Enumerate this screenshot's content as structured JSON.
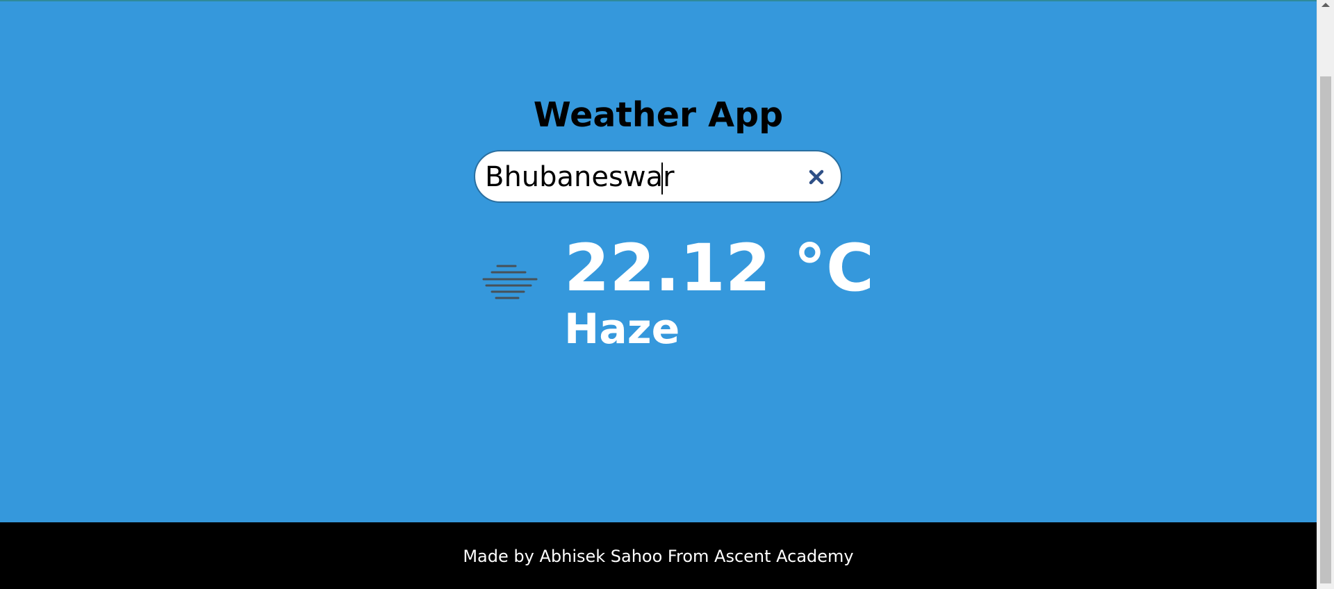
{
  "app": {
    "title": "Weather App"
  },
  "search": {
    "value": "Bhubaneswar",
    "clear_icon": "close-icon"
  },
  "weather": {
    "temperature": "22.12 °C",
    "condition": "Haze",
    "icon": "haze-icon"
  },
  "footer": {
    "text": "Made by Abhisek Sahoo From Ascent Academy"
  },
  "colors": {
    "background": "#3598dc",
    "footer": "#000000",
    "text_light": "#ffffff"
  }
}
